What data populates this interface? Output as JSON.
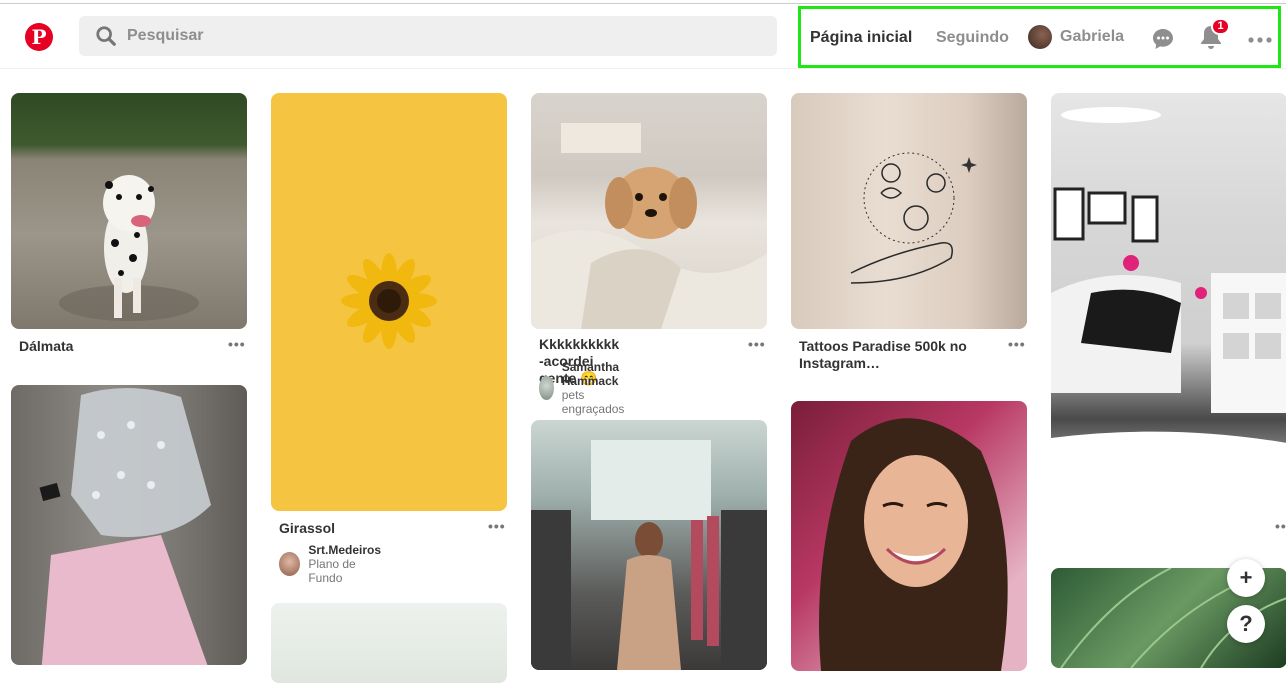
{
  "header": {
    "logo": "pinterest-logo",
    "search": {
      "placeholder": "Pesquisar",
      "value": ""
    },
    "nav": {
      "home_label": "Página inicial",
      "following_label": "Seguindo",
      "user_name": "Gabriela",
      "notifications_count": "1"
    },
    "highlight_color": "#1ee814",
    "brand_color": "#e60023"
  },
  "pins": [
    {
      "title": "Dálmata",
      "more": "•••"
    },
    {
      "title": "",
      "more": ""
    },
    {
      "title": "Girassol",
      "more": "•••",
      "author": "Srt.Medeiros",
      "board": "Plano de Fundo"
    },
    {
      "title": "",
      "more": ""
    },
    {
      "title": "Kkkkkkkkkk -acordei gente 😁",
      "more": "•••",
      "author": "Samantha Hammack",
      "board": "pets engraçados"
    },
    {
      "title": "",
      "more": ""
    },
    {
      "title": "Tattoos Paradise 500k no Instagram…",
      "more": "•••"
    },
    {
      "title": "",
      "more": ""
    },
    {
      "title": "",
      "more": "•••"
    },
    {
      "title": "",
      "more": ""
    }
  ],
  "floating": {
    "add": "+",
    "help": "?"
  }
}
